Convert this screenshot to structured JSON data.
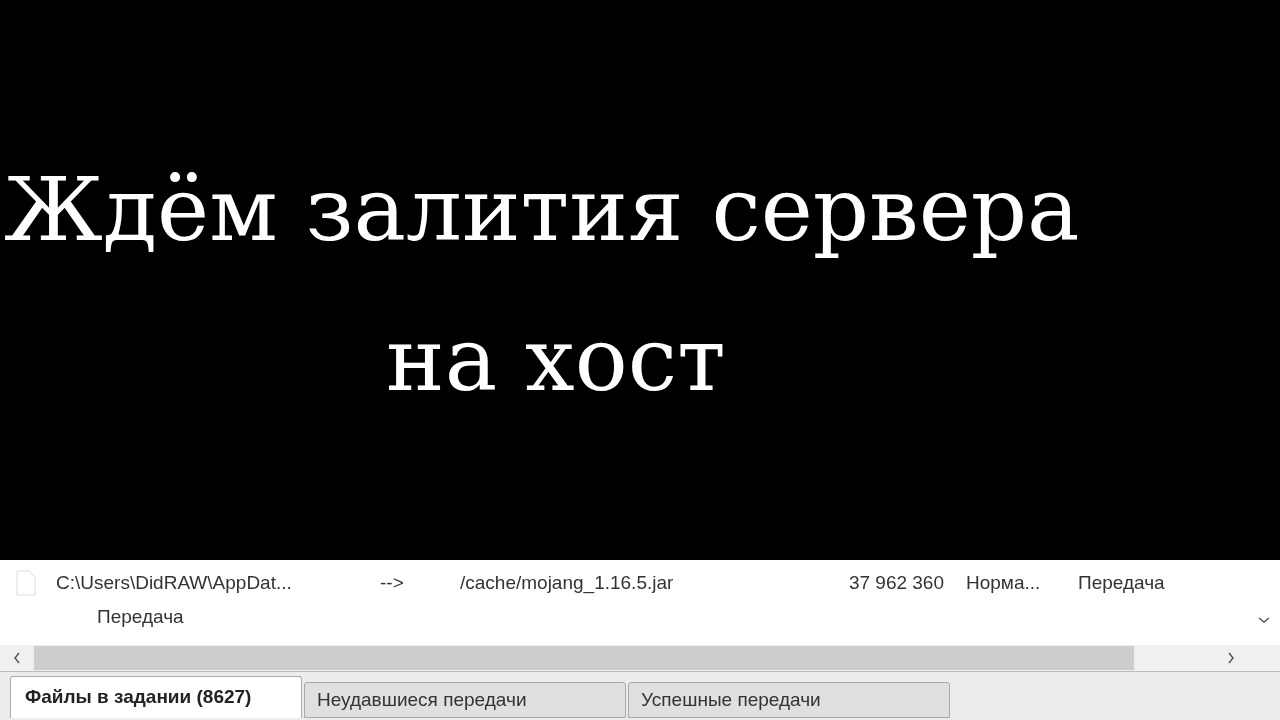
{
  "caption": [
    "Ждём залития сервера",
    "на хост"
  ],
  "queue": {
    "rows": [
      {
        "local_file": "C:\\Users\\DidRAW\\AppDat...",
        "direction": "-->",
        "remote_file": "/cache/mojang_1.16.5.jar",
        "size": "37 962 360",
        "priority": "Норма...",
        "status": "Передача",
        "detail": "Передача"
      }
    ]
  },
  "tabs": [
    {
      "label": "Файлы в задании (8627)",
      "selected": true
    },
    {
      "label": "Неудавшиеся передачи",
      "selected": false
    },
    {
      "label": "Успешные передачи",
      "selected": false
    }
  ]
}
